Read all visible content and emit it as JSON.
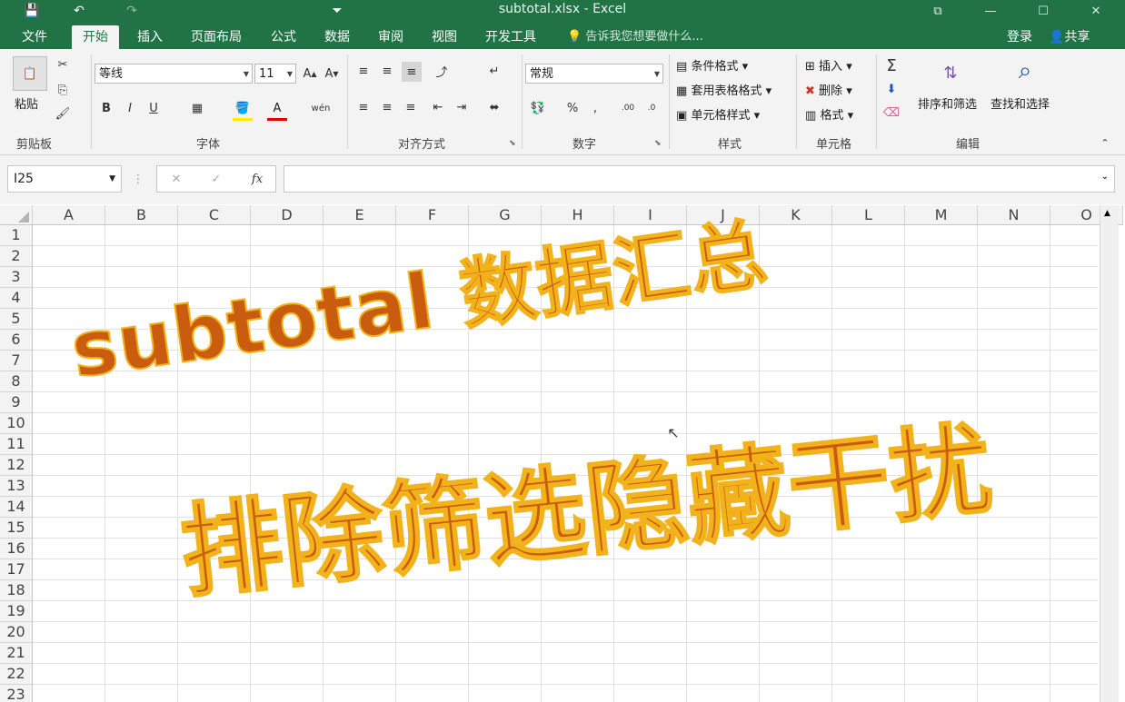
{
  "window": {
    "title": "subtotal.xlsx - Excel",
    "controls": [
      "⧉",
      "—",
      "☐",
      "✕"
    ]
  },
  "quick_access": [
    "💾",
    "↶",
    "↷",
    "⏷"
  ],
  "menu": {
    "file": "文件",
    "tabs": [
      "开始",
      "插入",
      "页面布局",
      "公式",
      "数据",
      "审阅",
      "视图",
      "开发工具"
    ],
    "tell_me": "告诉我您想要做什么...",
    "login": "登录",
    "share": "共享"
  },
  "ribbon": {
    "clipboard": {
      "paste": "粘贴",
      "label": "剪贴板"
    },
    "font": {
      "name": "等线",
      "size": "11",
      "bold": "B",
      "italic": "I",
      "underline": "U",
      "phonetic": "wén",
      "label": "字体"
    },
    "alignment": {
      "label": "对齐方式"
    },
    "number": {
      "format": "常规",
      "percent": "%",
      "comma": ",",
      "label": "数字"
    },
    "styles": {
      "conditional": "条件格式",
      "table": "套用表格格式",
      "cell": "单元格样式",
      "label": "样式"
    },
    "cells": {
      "insert": "插入",
      "delete": "删除",
      "format": "格式",
      "label": "单元格"
    },
    "editing": {
      "sort": "排序和筛选",
      "find": "查找和选择",
      "label": "编辑"
    }
  },
  "formula_bar": {
    "name_box": "I25",
    "fx": "fx",
    "content": ""
  },
  "grid": {
    "columns": [
      "A",
      "B",
      "C",
      "D",
      "E",
      "F",
      "G",
      "H",
      "I",
      "J",
      "K",
      "L",
      "M",
      "N",
      "O"
    ],
    "rows": [
      "1",
      "2",
      "3",
      "4",
      "5",
      "6",
      "7",
      "8",
      "9",
      "10",
      "11",
      "12",
      "13",
      "14",
      "15",
      "16",
      "17",
      "18",
      "19",
      "20",
      "21",
      "22",
      "23"
    ]
  },
  "overlay": {
    "line1": "subtotal 数据汇总",
    "line2": "排除筛选隐藏干扰",
    "fill_color": "#c95c0e",
    "stroke_color": "#f2b21c"
  },
  "colors": {
    "brand": "#217346",
    "ribbon_bg": "#f3f3f3"
  }
}
